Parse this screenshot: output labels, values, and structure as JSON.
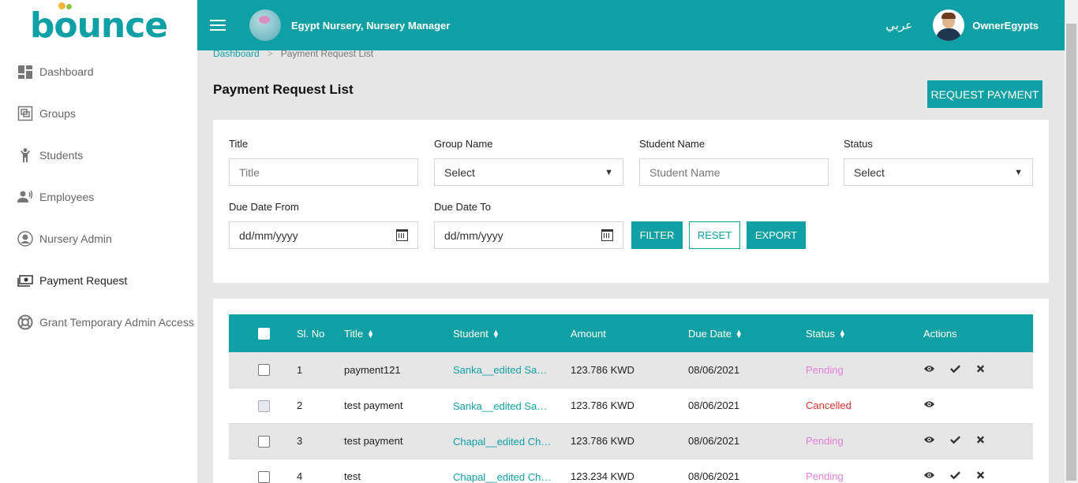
{
  "app": {
    "logo_text": "bounce"
  },
  "sidebar": {
    "items": [
      {
        "label": "Dashboard",
        "icon": "dashboard-icon"
      },
      {
        "label": "Groups",
        "icon": "groups-icon"
      },
      {
        "label": "Students",
        "icon": "student-icon"
      },
      {
        "label": "Employees",
        "icon": "employees-icon"
      },
      {
        "label": "Nursery Admin",
        "icon": "user-circle-icon"
      },
      {
        "label": "Payment Request",
        "icon": "money-icon"
      },
      {
        "label": "Grant Temporary Admin Access",
        "icon": "lifebuoy-icon"
      }
    ],
    "active_index": 5
  },
  "header": {
    "org_name": "Egypt Nursery, Nursery Manager",
    "language": "عربي",
    "user_name": "OwnerEgypts",
    "accent_color": "#0fa0a6"
  },
  "breadcrumb": {
    "home": "Dashboard",
    "current": "Payment Request List"
  },
  "page": {
    "title": "Payment Request List",
    "request_button": "REQUEST PAYMENT"
  },
  "filters": {
    "title_label": "Title",
    "title_placeholder": "Title",
    "group_label": "Group Name",
    "group_value": "Select",
    "student_label": "Student Name",
    "student_placeholder": "Student Name",
    "status_label": "Status",
    "status_value": "Select",
    "due_from_label": "Due Date From",
    "due_from_placeholder": "dd/mm/yyyy",
    "due_to_label": "Due Date To",
    "due_to_placeholder": "dd/mm/yyyy",
    "filter_button": "FILTER",
    "reset_button": "RESET",
    "export_button": "EXPORT"
  },
  "table": {
    "columns": [
      "Sl. No",
      "Title",
      "Student",
      "Amount",
      "Due Date",
      "Status",
      "Actions"
    ],
    "rows": [
      {
        "sl": "1",
        "title": "payment121",
        "student": "Sanka__edited Sanka__edited",
        "amount": "123.786 KWD",
        "due": "08/06/2021",
        "status": "Pending"
      },
      {
        "sl": "2",
        "title": "test payment",
        "student": "Sanka__edited Sanka__edited",
        "amount": "123.786 KWD",
        "due": "08/06/2021",
        "status": "Cancelled"
      },
      {
        "sl": "3",
        "title": "test payment",
        "student": "Chapal__edited Chapal__edited",
        "amount": "123.786 KWD",
        "due": "08/06/2021",
        "status": "Pending"
      },
      {
        "sl": "4",
        "title": "test",
        "student": "Chapal__edited Chapal__edited",
        "amount": "123.234 KWD",
        "due": "08/06/2021",
        "status": "Pending"
      }
    ]
  }
}
